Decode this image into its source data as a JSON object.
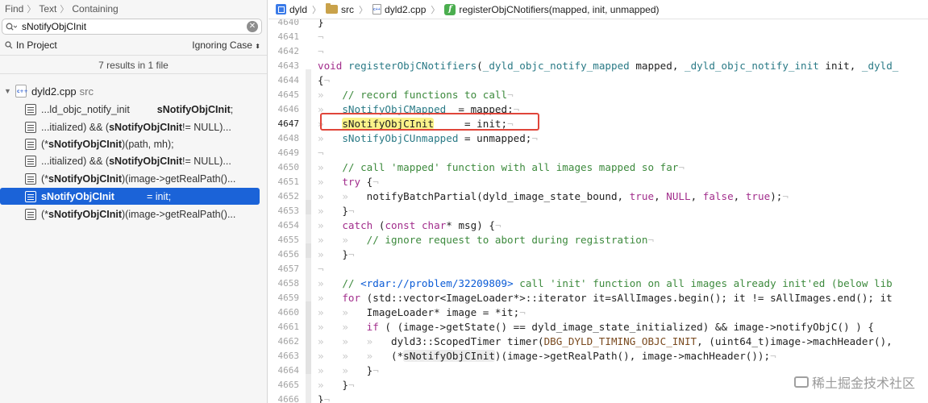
{
  "find": {
    "crumbs": [
      "Find",
      "Text",
      "Containing"
    ],
    "query": "sNotifyObjCInit",
    "scope": "In Project",
    "case_mode": "Ignoring Case",
    "summary": "7 results in 1 file",
    "file": {
      "name": "dyld2.cpp",
      "dir": "src"
    },
    "results": [
      {
        "pre": "...ld_objc_notify_init",
        "match": "sNotifyObjCInit",
        "post": ";"
      },
      {
        "pre": "...itialized) && (",
        "match": "sNotifyObjCInit",
        "post": " != NULL)..."
      },
      {
        "pre": "(*",
        "match": "sNotifyObjCInit",
        "post": ")(path, mh);"
      },
      {
        "pre": "...itialized) && (",
        "match": "sNotifyObjCInit",
        "post": " != NULL)..."
      },
      {
        "pre": "(*",
        "match": "sNotifyObjCInit",
        "post": ")(image->getRealPath()..."
      },
      {
        "pre": "",
        "match": "sNotifyObjCInit",
        "post": "= init;"
      },
      {
        "pre": "(*",
        "match": "sNotifyObjCInit",
        "post": ")(image->getRealPath()..."
      }
    ],
    "selected_index": 5
  },
  "jumpbar": {
    "project": "dyld",
    "folder": "src",
    "file": "dyld2.cpp",
    "function": "registerObjCNotifiers(mapped, init, unmapped)"
  },
  "editor": {
    "current_line": 4647,
    "line_numbers": [
      4640,
      4641,
      4642,
      4643,
      4644,
      4645,
      4646,
      4647,
      4648,
      4649,
      4650,
      4651,
      4652,
      4653,
      4654,
      4655,
      4656,
      4657,
      4658,
      4659,
      4660,
      4661,
      4662,
      4663,
      4664,
      4665,
      4666
    ],
    "code": {
      "l4640": "}",
      "l4643_kw": "void",
      "l4643_fn": "registerObjCNotifiers",
      "l4643_t1": "_dyld_objc_notify_mapped",
      "l4643_a1": " mapped, ",
      "l4643_t2": "_dyld_objc_notify_init",
      "l4643_a2": " init, ",
      "l4643_t3": "_dyld_",
      "l4644": "{",
      "l4645": "// record functions to call",
      "l4646_var": "sNotifyObjCMapped",
      "l4646_rest": "  = mapped;",
      "l4647_var": "sNotifyObjCInit",
      "l4647_rest": "     = init;",
      "l4648_var": "sNotifyObjCUnmapped",
      "l4648_rest": " = unmapped;",
      "l4650": "// call 'mapped' function with all images mapped so far",
      "l4651": "try",
      "l4651_rest": " {",
      "l4652_fn": "notifyBatchPartial",
      "l4652_a": "(dyld_image_state_bound, ",
      "l4652_true": "true",
      "l4652_null": "NULL",
      "l4652_false": "false",
      "l4652_true2": "true",
      "l4652_end": ");",
      "l4653": "}",
      "l4654_kw": "catch",
      "l4654_const": "const",
      "l4654_char": "char",
      "l4654_rest": "* msg) {",
      "l4655": "// ignore request to abort during registration",
      "l4656": "}",
      "l4658_cm1": "// ",
      "l4658_url": "<rdar://problem/32209809>",
      "l4658_cm2": " call 'init' function on all images already init'ed (below lib",
      "l4659_kw": "for",
      "l4659_rest": " (std::vector<ImageLoader*>::iterator it=sAllImages.begin(); it != sAllImages.end(); it",
      "l4660": "ImageLoader* image = *it;",
      "l4661_kw": "if",
      "l4661_rest": " ( (image->getState() == dyld_image_state_initialized) && image->notifyObjC() ) {",
      "l4662_a": "dyld3::ScopedTimer timer(",
      "l4662_macro": "DBG_DYLD_TIMING_OBJC_INIT",
      "l4662_b": ", (uint64_t)image->machHeader(), ",
      "l4663_a": "(*",
      "l4663_var": "sNotifyObjCInit",
      "l4663_b": ")(image->getRealPath(), image->machHeader());",
      "l4664": "}",
      "l4665": "}",
      "l4666": "}"
    }
  },
  "watermark": "稀土掘金技术社区",
  "colors": {
    "selection": "#1b63d8",
    "keyword": "#a22e8c",
    "comment": "#3d8a3d",
    "highlight": "#fbf38a",
    "annotation_box": "#e0453a"
  }
}
